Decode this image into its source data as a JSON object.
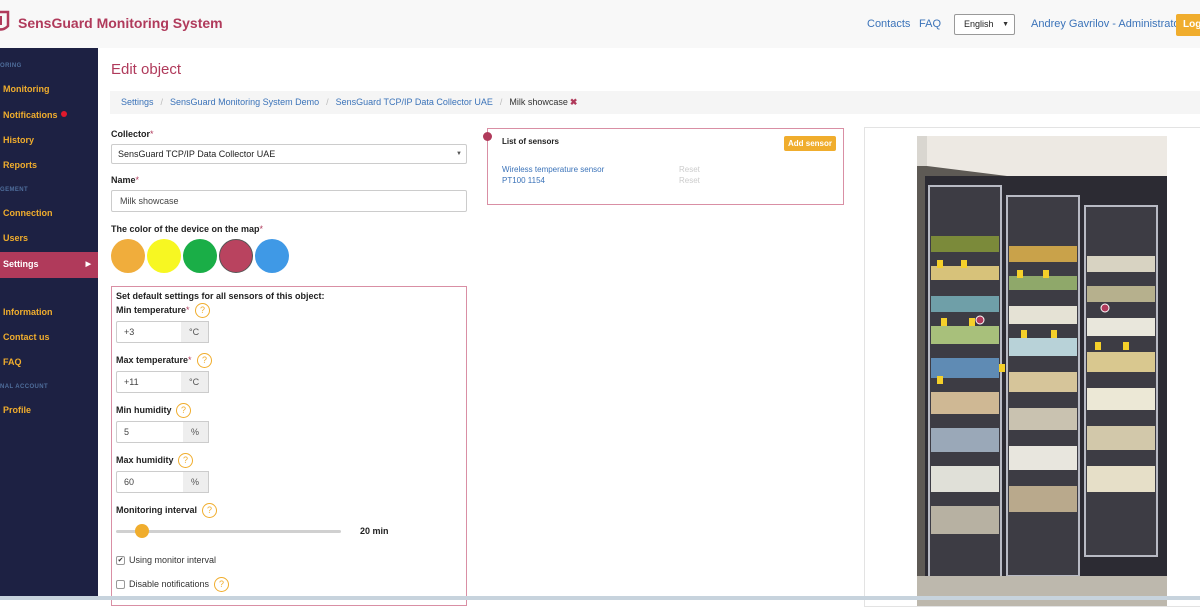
{
  "header": {
    "brand": "SensGuard Monitoring System",
    "nav": {
      "contacts": "Contacts",
      "faq": "FAQ"
    },
    "language": "English",
    "user": "Andrey Gavrilov - Administrator",
    "logout": "Log"
  },
  "sidebar": {
    "sections": [
      "ORING",
      "GEMENT",
      "NAL ACCOUNT"
    ],
    "items": {
      "monitoring": "Monitoring",
      "notifications": "Notifications",
      "history": "History",
      "reports": "Reports",
      "connection": "Connection",
      "users": "Users",
      "settings": "Settings",
      "information": "Information",
      "contact_us": "Contact us",
      "faq": "FAQ",
      "profile": "Profile"
    }
  },
  "page": {
    "title": "Edit object",
    "breadcrumb": [
      "Settings",
      "SensGuard Monitoring System Demo",
      "SensGuard TCP/IP Data Collector UAE",
      "Milk showcase"
    ]
  },
  "form": {
    "collector_label": "Collector",
    "collector_value": "SensGuard TCP/IP Data Collector UAE",
    "name_label": "Name",
    "name_value": "Milk showcase",
    "color_label": "The color of the device on the map",
    "required_mark": "*",
    "colors": [
      "#f0ad3c",
      "#f7f722",
      "#1aae47",
      "#b9435f",
      "#3f99e6"
    ],
    "defaults_title": "Set default settings for all sensors of this object:",
    "min_temp_label": "Min temperature",
    "min_temp_value": "+3",
    "max_temp_label": "Max temperature",
    "max_temp_value": "+11",
    "temp_unit": "°C",
    "min_hum_label": "Min humidity",
    "min_hum_value": "5",
    "max_hum_label": "Max humidity",
    "max_hum_value": "60",
    "hum_unit": "%",
    "interval_label": "Monitoring interval",
    "interval_value": "20 min",
    "use_interval_label": "Using monitor interval",
    "disable_notifications_label": "Disable notifications",
    "help_glyph": "?"
  },
  "sensors": {
    "title": "List of sensors",
    "add_button": "Add sensor",
    "items": [
      {
        "name": "Wireless temperature sensor",
        "action": "Reset"
      },
      {
        "name": "PT100 1154",
        "action": "Reset"
      }
    ]
  }
}
